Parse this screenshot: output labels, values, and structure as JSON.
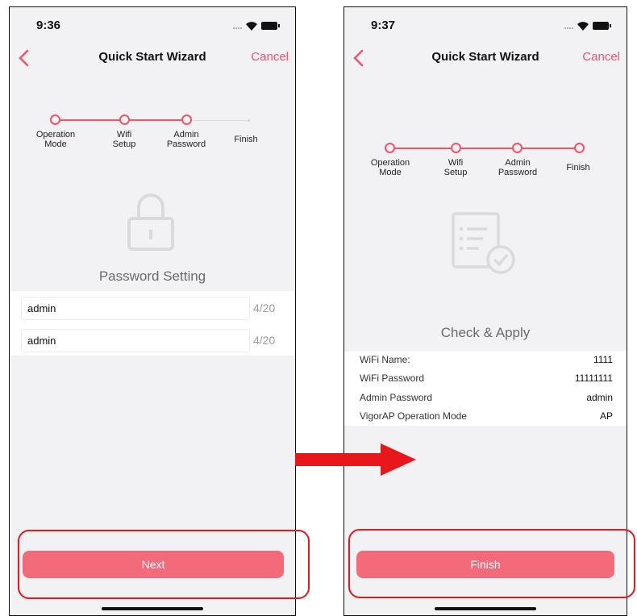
{
  "left_screen": {
    "status_time": "9:36",
    "nav": {
      "title": "Quick Start Wizard",
      "cancel_label": "Cancel"
    },
    "steps": [
      {
        "label": "Operation\nMode"
      },
      {
        "label": "Wifi\nSetup"
      },
      {
        "label": "Admin\nPassword"
      },
      {
        "label": "Finish"
      }
    ],
    "section_title": "Password Setting",
    "fields": [
      {
        "value": "admin",
        "counter": "4/20"
      },
      {
        "value": "admin",
        "counter": "4/20"
      }
    ],
    "button_label": "Next"
  },
  "right_screen": {
    "status_time": "9:37",
    "nav": {
      "title": "Quick Start Wizard",
      "cancel_label": "Cancel"
    },
    "steps": [
      {
        "label": "Operation\nMode"
      },
      {
        "label": "Wifi\nSetup"
      },
      {
        "label": "Admin\nPassword"
      },
      {
        "label": "Finish"
      }
    ],
    "section_title": "Check & Apply",
    "summary": [
      {
        "label": "WiFi Name:",
        "value": "1111"
      },
      {
        "label": "WiFi Password",
        "value": "11111111"
      },
      {
        "label": "Admin Password",
        "value": "admin"
      },
      {
        "label": "VigorAP Operation Mode",
        "value": "AP"
      }
    ],
    "button_label": "Finish"
  },
  "colors": {
    "accent": "#f0546a",
    "button": "#f36b7b",
    "highlight": "#e8171b",
    "arrow": "#e8171b"
  },
  "icons": [
    "back-chevron-icon",
    "wifi-icon",
    "battery-icon",
    "lock-icon",
    "checklist-icon",
    "arrow-right-icon"
  ]
}
